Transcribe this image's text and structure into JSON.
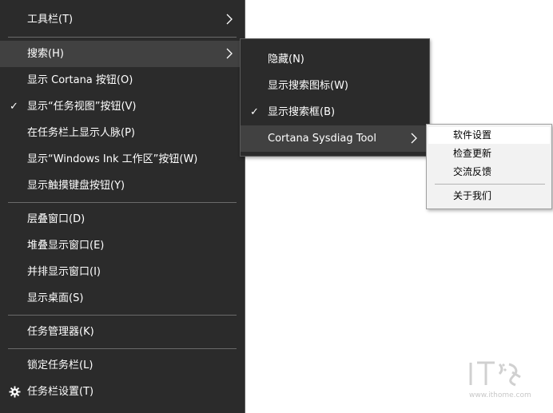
{
  "main_menu": {
    "items": [
      {
        "label": "工具栏(T)",
        "checked": false,
        "submenu": true
      },
      {
        "label": "搜索(H)",
        "checked": false,
        "submenu": true,
        "highlighted": true
      },
      {
        "label": "显示 Cortana 按钮(O)",
        "checked": false
      },
      {
        "label": "显示“任务视图”按钮(V)",
        "checked": true
      },
      {
        "label": "在任务栏上显示人脉(P)",
        "checked": false
      },
      {
        "label": "显示“Windows Ink 工作区”按钮(W)",
        "checked": false
      },
      {
        "label": "显示触摸键盘按钮(Y)",
        "checked": false
      },
      {
        "label": "层叠窗口(D)",
        "checked": false
      },
      {
        "label": "堆叠显示窗口(E)",
        "checked": false
      },
      {
        "label": "并排显示窗口(I)",
        "checked": false
      },
      {
        "label": "显示桌面(S)",
        "checked": false
      },
      {
        "label": "任务管理器(K)",
        "checked": false
      },
      {
        "label": "锁定任务栏(L)",
        "checked": false
      },
      {
        "label": "任务栏设置(T)",
        "checked": false,
        "icon": "gear-icon"
      }
    ]
  },
  "search_submenu": {
    "items": [
      {
        "label": "隐藏(N)",
        "checked": false
      },
      {
        "label": "显示搜索图标(W)",
        "checked": false
      },
      {
        "label": "显示搜索框(B)",
        "checked": true
      },
      {
        "label": "Cortana Sysdiag Tool",
        "checked": false,
        "submenu": true,
        "highlighted": true
      }
    ]
  },
  "cortana_submenu": {
    "items": [
      {
        "label": "软件设置",
        "highlighted": true
      },
      {
        "label": "检查更新"
      },
      {
        "label": "交流反馈"
      },
      {
        "label": "关于我们"
      }
    ]
  },
  "glyphs": {
    "check": "✓"
  },
  "watermark": {
    "icon": "ithome-logo-icon",
    "text": "www.ithome.com"
  },
  "colors": {
    "menu_bg": "#2b2b2b",
    "menu_hover": "#414141",
    "menu_text": "#ffffff",
    "light_menu_bg": "#f2f2f2",
    "light_menu_hover": "#ffffff"
  }
}
